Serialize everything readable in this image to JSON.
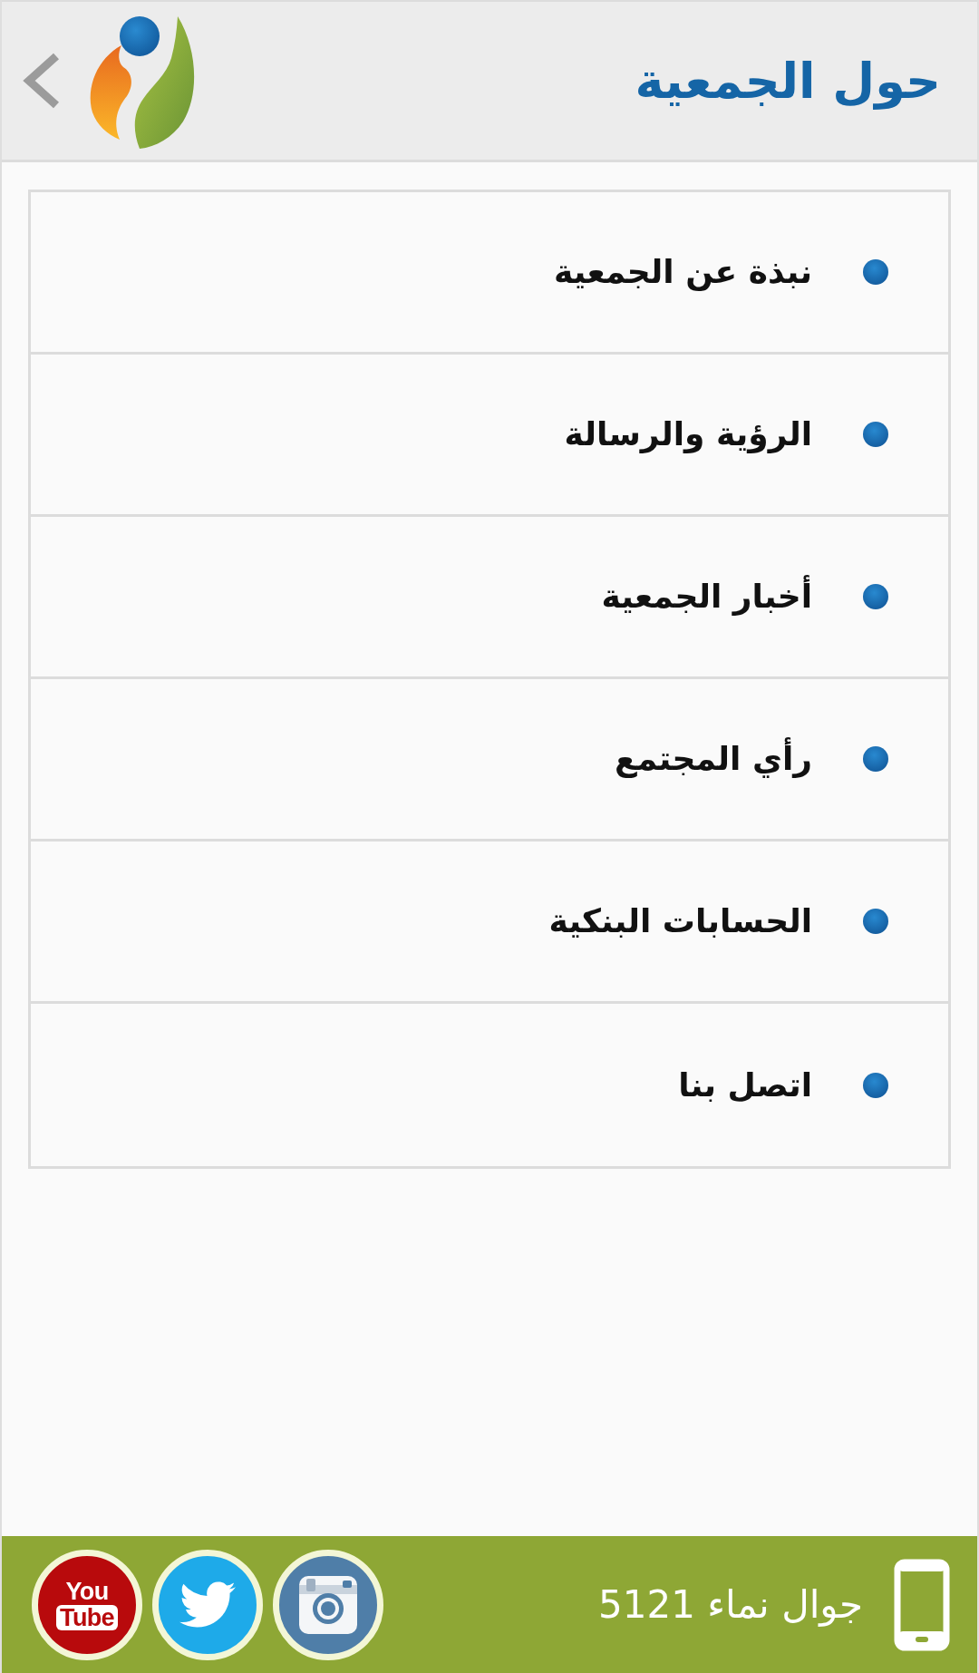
{
  "header": {
    "title": "حول الجمعية"
  },
  "menu": {
    "items": [
      {
        "label": "نبذة عن الجمعية"
      },
      {
        "label": "الرؤية والرسالة"
      },
      {
        "label": "أخبار الجمعية"
      },
      {
        "label": "رأي المجتمع"
      },
      {
        "label": "الحسابات البنكية"
      },
      {
        "label": "اتصل بنا"
      }
    ]
  },
  "footer": {
    "contact": "جوال نماء 5121",
    "social": [
      {
        "kind": "youtube",
        "lines": [
          "You",
          "Tube"
        ]
      },
      {
        "kind": "twitter"
      },
      {
        "kind": "instagram"
      }
    ]
  }
}
